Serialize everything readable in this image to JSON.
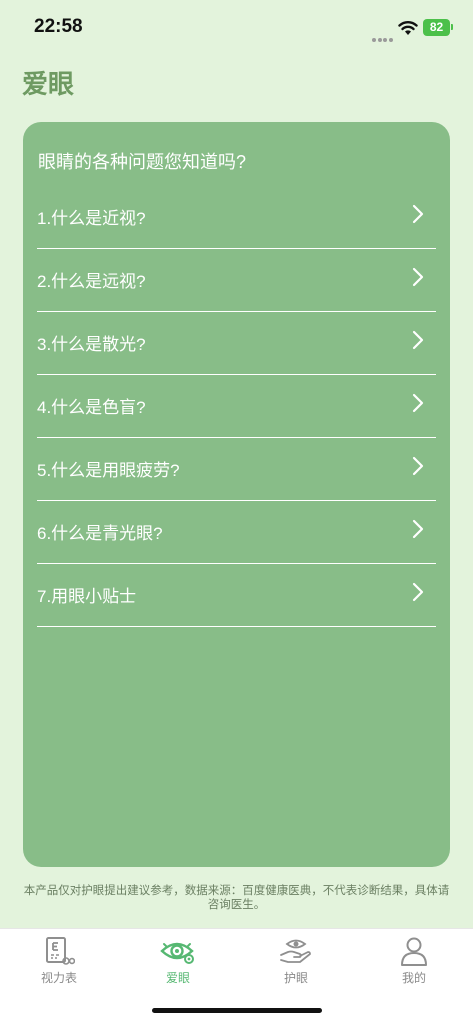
{
  "status_bar": {
    "time": "22:58",
    "battery": "82"
  },
  "page": {
    "title": "爱眼"
  },
  "card": {
    "title": "眼睛的各种问题您知道吗?",
    "items": [
      {
        "label": "1.什么是近视?"
      },
      {
        "label": "2.什么是远视?"
      },
      {
        "label": "3.什么是散光?"
      },
      {
        "label": "4.什么是色盲?"
      },
      {
        "label": "5.什么是用眼疲劳?"
      },
      {
        "label": "6.什么是青光眼?"
      },
      {
        "label": "7.用眼小贴士"
      }
    ]
  },
  "disclaimer": "本产品仅对护眼提出建议参考，数据来源：百度健康医典，不代表诊断结果，具体请咨询医生。",
  "tabs": [
    {
      "label": "视力表",
      "icon": "eye-chart-icon",
      "active": false
    },
    {
      "label": "爱眼",
      "icon": "eye-icon",
      "active": true
    },
    {
      "label": "护眼",
      "icon": "hand-eye-icon",
      "active": false
    },
    {
      "label": "我的",
      "icon": "person-icon",
      "active": false
    }
  ],
  "colors": {
    "background": "#e3f3dc",
    "card": "#88bd88",
    "title": "#6e9a62",
    "active_tab": "#56b872"
  }
}
